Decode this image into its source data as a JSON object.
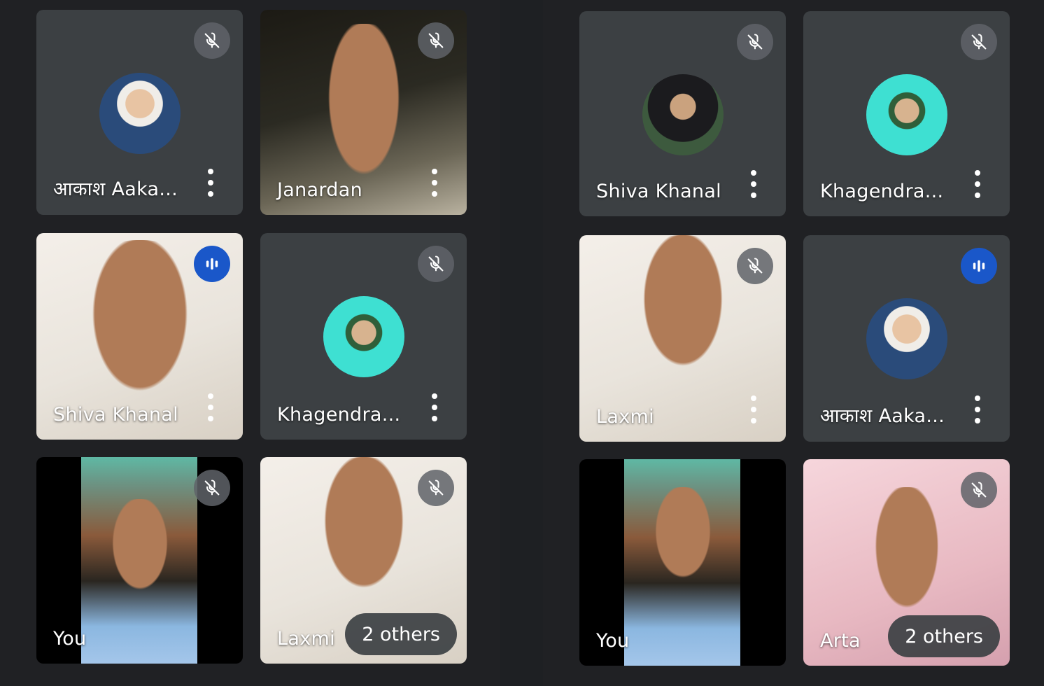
{
  "left_grid": {
    "tiles": [
      {
        "name": "आकाश Aaka...",
        "mic": "muted"
      },
      {
        "name": "Janardan",
        "mic": "muted"
      },
      {
        "name": "Shiva Khanal",
        "mic": "speaking"
      },
      {
        "name": "Khagendra...",
        "mic": "muted"
      },
      {
        "name": "You",
        "mic": "muted"
      },
      {
        "name": "Laxmi",
        "mic": "muted"
      }
    ],
    "overflow_label": "2 others"
  },
  "right_grid": {
    "tiles": [
      {
        "name": "Shiva Khanal",
        "mic": "muted"
      },
      {
        "name": "Khagendra...",
        "mic": "muted"
      },
      {
        "name": "Laxmi",
        "mic": "muted"
      },
      {
        "name": "आकाश Aaka...",
        "mic": "speaking"
      },
      {
        "name": "You",
        "mic": "none"
      },
      {
        "name": "Arta",
        "mic": "muted"
      }
    ],
    "overflow_label": "2 others"
  },
  "icons": {
    "muted": "mic-off-icon",
    "speaking": "audio-level-icon",
    "options": "more-vert-icon"
  },
  "colors": {
    "background": "#202124",
    "tile": "#3c4043",
    "speaking": "#1a57c9"
  }
}
